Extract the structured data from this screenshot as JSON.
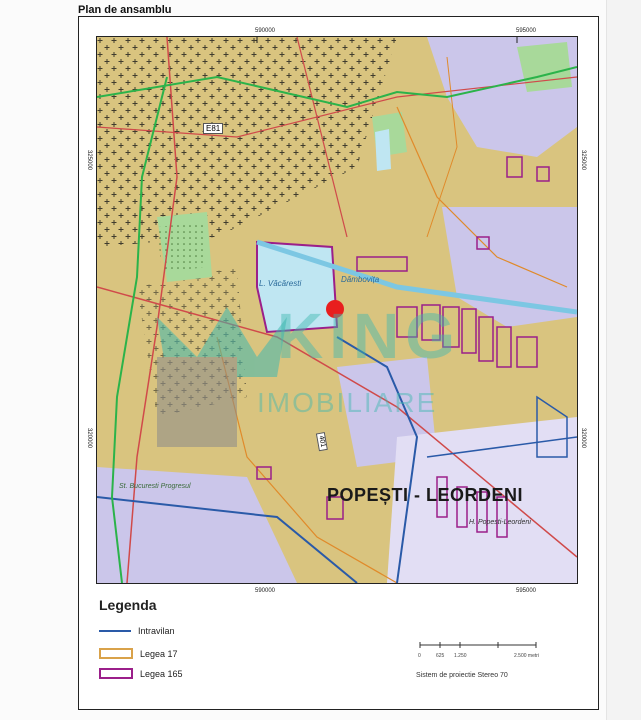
{
  "page_title": "Plan de ansamblu",
  "coords": {
    "top_left": "590000",
    "top_right": "595000",
    "bottom_left": "590000",
    "bottom_right": "595000",
    "left_upper": "325000",
    "left_lower": "320000",
    "right_upper": "325000",
    "right_lower": "320000"
  },
  "map_labels": {
    "road_label": "E81",
    "lake_label": "L. Văcăresti",
    "river_label": "Dâmbovița",
    "road_401": "401",
    "station_label": "St. Bucuresti Progresul",
    "town_name": "POPEȘTI - LEORDENI",
    "halt_label": "H. Popesti-Leordeni",
    "watermark_line1": "KING",
    "watermark_line2": "IMOBILIARE"
  },
  "legend": {
    "title": "Legenda",
    "items": [
      {
        "label": "Intravilan",
        "color": "#2a5aa8",
        "style": "line"
      },
      {
        "label": "Legea 17",
        "color": "#d9a24a",
        "style": "box"
      },
      {
        "label": "Legea 165",
        "color": "#9b1f8a",
        "style": "box"
      }
    ]
  },
  "scale": {
    "ticks": [
      "0",
      "625",
      "1.250",
      "2.500 metri"
    ]
  },
  "projection": "Sistem de proiectie Stereo 70",
  "colors": {
    "background_tan": "#d9c47f",
    "lavender": "#cbc6ea",
    "green_border": "#2bb34a",
    "red_road": "#d04a4a",
    "marker_red": "#e81e1e",
    "water": "#bfe6f2",
    "watermark_teal": "#3fb8b0"
  }
}
